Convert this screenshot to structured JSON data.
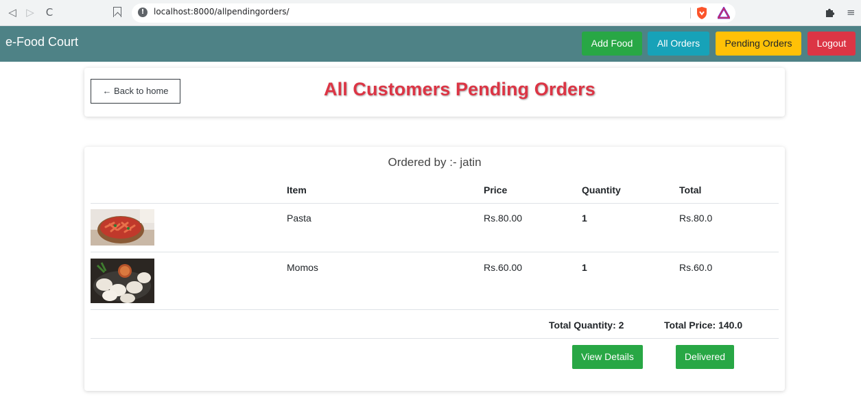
{
  "browser": {
    "url": "localhost:8000/allpendingorders/",
    "icons": [
      "back-icon",
      "forward-icon",
      "reload-icon",
      "bookmark-icon",
      "info-icon",
      "brave-shield-icon",
      "brave-rewards-icon",
      "extensions-icon",
      "menu-icon"
    ]
  },
  "navbar": {
    "brand": "e-Food Court",
    "buttons": [
      {
        "label": "Add Food",
        "color": "#28a745"
      },
      {
        "label": "All Orders",
        "color": "#17a2b8"
      },
      {
        "label": "Pending Orders",
        "color": "#ffc107"
      },
      {
        "label": "Logout",
        "color": "#dc3545"
      }
    ],
    "background": "#4e8286"
  },
  "header": {
    "back_label": "← Back to home",
    "title": "All Customers Pending Orders",
    "title_color": "#dc3545"
  },
  "order": {
    "ordered_by": "Ordered by :- jatin",
    "columns": {
      "item": "Item",
      "price": "Price",
      "quantity": "Quantity",
      "total": "Total"
    },
    "rows": [
      {
        "image": "pasta-image",
        "item": "Pasta",
        "price": "Rs.80.00",
        "quantity": "1",
        "total": "Rs.80.0"
      },
      {
        "image": "momos-image",
        "item": "Momos",
        "price": "Rs.60.00",
        "quantity": "1",
        "total": "Rs.60.0"
      }
    ],
    "total_quantity": "Total Quantity: 2",
    "total_price": "Total Price: 140.0",
    "view_details_label": "View Details",
    "delivered_label": "Delivered"
  }
}
